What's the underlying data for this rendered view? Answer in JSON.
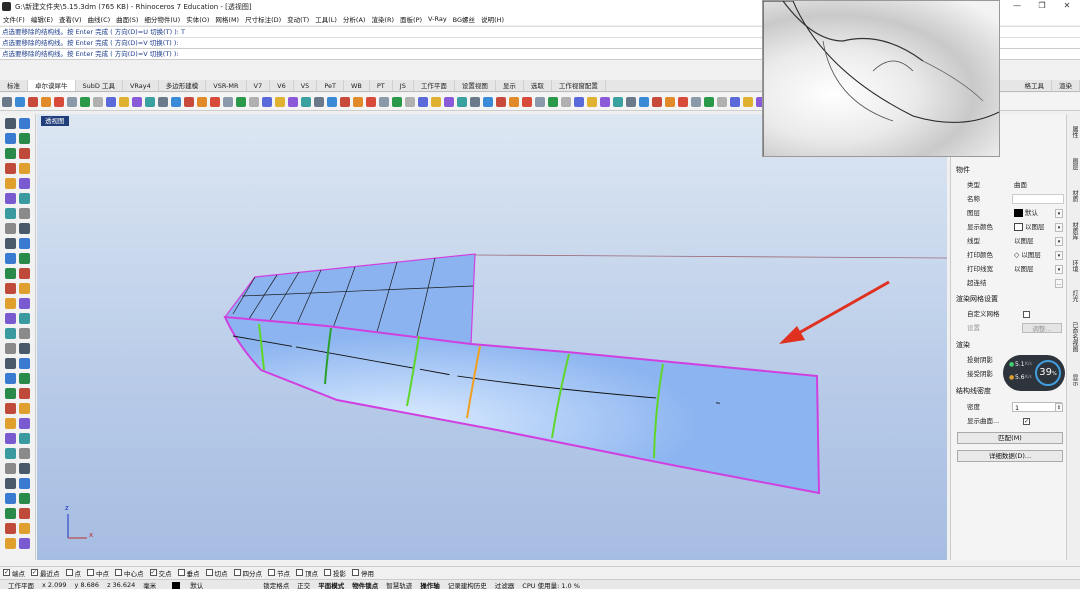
{
  "window": {
    "title": "G:\\新建文件夹\\5.15.3dm (765 KB) - Rhinoceros 7 Education - [透视图]",
    "minimize": "—",
    "restore": "❐",
    "close": "✕"
  },
  "menu": [
    "文件(F)",
    "编辑(E)",
    "查看(V)",
    "曲线(C)",
    "曲面(S)",
    "细分物件(U)",
    "实体(O)",
    "网格(M)",
    "尺寸标注(D)",
    "变动(T)",
    "工具(L)",
    "分析(A)",
    "渲染(R)",
    "面板(P)",
    "V-Ray",
    "BG螺丝",
    "说明(H)"
  ],
  "command": {
    "line1": "点选要移除的结构线。按 Enter 完成 ( 方向(D)=U  切换(T) ): T",
    "line2": "点选要移除的结构线。按 Enter 完成 ( 方向(D)=V  切换(T) ):",
    "prompt": "点选要移除的结构线。按 Enter 完成 ( 方向(D)=V  切换(T) ):"
  },
  "tabs": [
    "标准",
    "卓尔谟犀牛",
    "SubD 工具",
    "VRay4",
    "多边形建模",
    "VSR-MR",
    "V7",
    "V6",
    "V5",
    "PeT",
    "WB",
    "PT",
    "JS",
    "工作平面",
    "设置视图",
    "显示",
    "选取",
    "工作视窗配置"
  ],
  "tab_right": "格工具",
  "tab_far_right": "渲染",
  "viewport": {
    "label": "透视图",
    "axis_z": "z",
    "axis_x": "x"
  },
  "properties": {
    "object_header": "物件",
    "rows": [
      {
        "label": "类型",
        "value": "曲面"
      },
      {
        "label": "名称",
        "value": ""
      },
      {
        "label": "图层",
        "value": "默认"
      },
      {
        "label": "显示颜色",
        "value": "以图层"
      },
      {
        "label": "线型",
        "value": "以图层"
      },
      {
        "label": "打印颜色",
        "value": "以图层"
      },
      {
        "label": "打印线宽",
        "value": "以图层"
      },
      {
        "label": "超连结",
        "value": ""
      }
    ],
    "mesh_header": "渲染网格设置",
    "custom_mesh": "自定义网格",
    "settings_label": "设置",
    "adjust_button": "调整...",
    "render_header": "渲染",
    "cast_shadow": "投射阴影",
    "receive_shadow": "接受阴影",
    "isocurve_header": "结构线密度",
    "density_label": "密度",
    "density_value": "1",
    "show_surface": "显示曲面...",
    "match_button": "匹配(M)",
    "details_button": "详细数据(D)..."
  },
  "right_strip": [
    "属性",
    "图层",
    "材质",
    "材质库",
    "环境",
    "灯光",
    "已命名视图",
    "显示"
  ],
  "cpu_widget": {
    "up": "5.1",
    "down": "5.6",
    "up_unit": "K/s",
    "down_unit": "K/s",
    "percent": "39",
    "percent_sign": "%"
  },
  "osnaps": [
    {
      "label": "端点",
      "checked": true
    },
    {
      "label": "最近点",
      "checked": true
    },
    {
      "label": "点",
      "checked": false
    },
    {
      "label": "中点",
      "checked": false
    },
    {
      "label": "中心点",
      "checked": false
    },
    {
      "label": "交点",
      "checked": true
    },
    {
      "label": "垂点",
      "checked": false
    },
    {
      "label": "切点",
      "checked": false
    },
    {
      "label": "四分点",
      "checked": false
    },
    {
      "label": "节点",
      "checked": false
    },
    {
      "label": "顶点",
      "checked": false
    },
    {
      "label": "投影",
      "checked": false
    },
    {
      "label": "停用",
      "checked": false
    }
  ],
  "status": {
    "cplane": "工作平面",
    "x": "x 2.099",
    "y": "y 8.686",
    "z": "z 36.624",
    "units": "毫米",
    "layer": "默认",
    "grid_snap": "锁定格点",
    "ortho": "正交",
    "planar": "平面模式",
    "osnap": "物件锁点",
    "smarttrack": "智慧轨迹",
    "gumball": "操作轴",
    "history": "记录建构历史",
    "filter": "过滤器",
    "cpu": "CPU 使用量: 1.0 %"
  },
  "colors": {
    "surface": "#8cb4f0",
    "edge": "#d040e0",
    "isocurve": "#222222",
    "highlight_green": "#5fd62a",
    "highlight_orange": "#f0a020",
    "arrow": "#e03020",
    "viewport_top": "#dde7f3",
    "viewport_bottom": "#a6bde2"
  }
}
